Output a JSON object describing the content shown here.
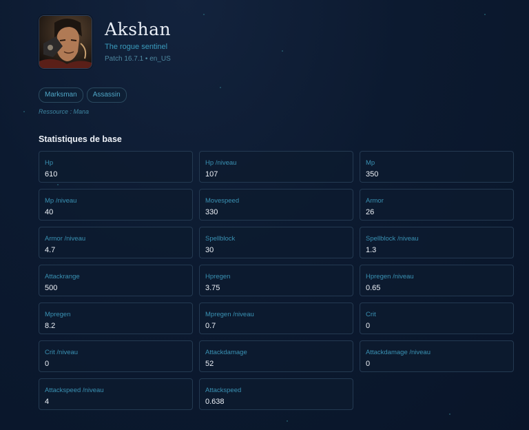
{
  "champion": {
    "name": "Akshan",
    "title": "The rogue sentinel",
    "patch": "Patch 16.7.1 • en_US",
    "portrait_alt": "Akshan"
  },
  "tags": [
    "Marksman",
    "Assassin"
  ],
  "resource": "Ressource : Mana",
  "stats_section": {
    "title": "Statistiques de base",
    "items": [
      {
        "label": "Hp",
        "value": "610"
      },
      {
        "label": "Hp /niveau",
        "value": "107"
      },
      {
        "label": "Mp",
        "value": "350"
      },
      {
        "label": "Mp /niveau",
        "value": "40"
      },
      {
        "label": "Movespeed",
        "value": "330"
      },
      {
        "label": "Armor",
        "value": "26"
      },
      {
        "label": "Armor /niveau",
        "value": "4.7"
      },
      {
        "label": "Spellblock",
        "value": "30"
      },
      {
        "label": "Spellblock /niveau",
        "value": "1.3"
      },
      {
        "label": "Attackrange",
        "value": "500"
      },
      {
        "label": "Hpregen",
        "value": "3.75"
      },
      {
        "label": "Hpregen /niveau",
        "value": "0.65"
      },
      {
        "label": "Mpregen",
        "value": "8.2"
      },
      {
        "label": "Mpregen /niveau",
        "value": "0.7"
      },
      {
        "label": "Crit",
        "value": "0"
      },
      {
        "label": "Crit /niveau",
        "value": "0"
      },
      {
        "label": "Attackdamage",
        "value": "52"
      },
      {
        "label": "Attackdamage /niveau",
        "value": "0"
      },
      {
        "label": "Attackspeed /niveau",
        "value": "4"
      },
      {
        "label": "Attackspeed",
        "value": "0.638"
      }
    ]
  },
  "colors": {
    "background": "#0c1a30",
    "accent": "#3a92b4",
    "card_border": "#243a52",
    "text": "#eef2f8"
  }
}
